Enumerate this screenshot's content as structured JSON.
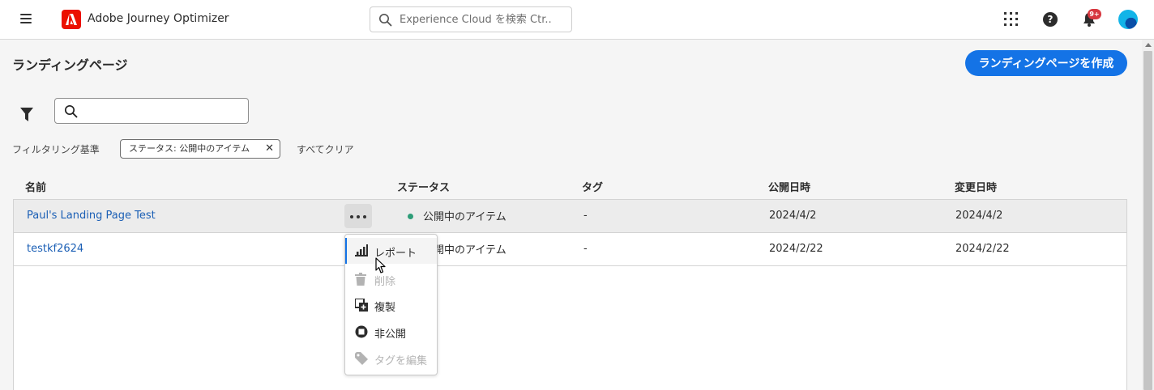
{
  "app": {
    "title": "Adobe Journey Optimizer",
    "search_placeholder": "Experience Cloud を検索 Ctr..",
    "notification_badge": "9+"
  },
  "page": {
    "title": "ランディングページ",
    "create_button": "ランディングページを作成",
    "search_value": ""
  },
  "filters": {
    "label": "フィルタリング基準",
    "tag": "ステータス: 公開中のアイテム",
    "clear_all": "すべてクリア"
  },
  "table": {
    "columns": [
      "名前",
      "ステータス",
      "タグ",
      "公開日時",
      "変更日時"
    ],
    "rows": [
      {
        "name": "Paul's Landing Page Test",
        "status": "公開中のアイテム",
        "tag": "-",
        "published": "2024/4/2",
        "modified": "2024/4/2"
      },
      {
        "name": "testkf2624",
        "status": "公開中のアイテム",
        "tag": "-",
        "published": "2024/2/22",
        "modified": "2024/2/22"
      }
    ]
  },
  "context_menu": {
    "items": [
      {
        "label": "レポート",
        "icon": "chart-icon",
        "disabled": false,
        "active": true
      },
      {
        "label": "削除",
        "icon": "trash-icon",
        "disabled": true
      },
      {
        "label": "複製",
        "icon": "duplicate-icon",
        "disabled": false
      },
      {
        "label": "非公開",
        "icon": "stop-icon",
        "disabled": false
      },
      {
        "label": "タグを編集",
        "icon": "tag-icon",
        "disabled": true
      }
    ]
  },
  "colors": {
    "accent": "#1473e6",
    "status_live": "#2d9d78",
    "brand": "#eb1000"
  }
}
